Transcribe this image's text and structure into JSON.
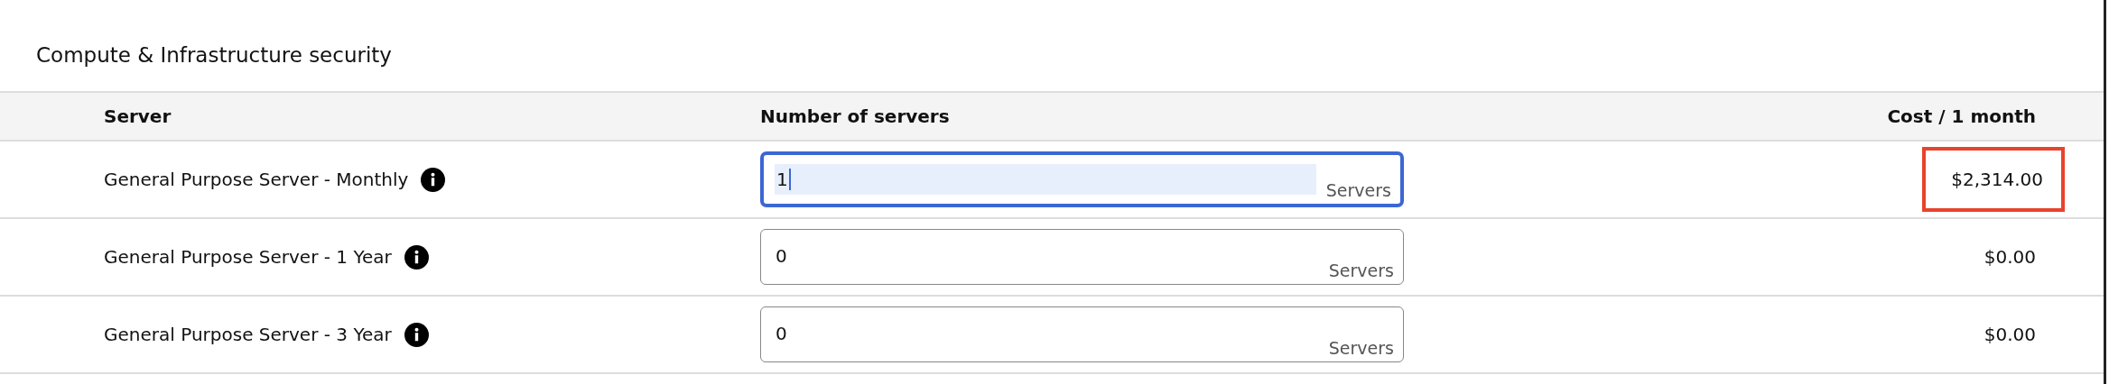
{
  "section": {
    "title": "Compute & Infrastructure security"
  },
  "table": {
    "columns": [
      "Server",
      "Number of servers",
      "Cost / 1 month"
    ],
    "rows": [
      {
        "server": "General Purpose Server - Monthly",
        "quantity": {
          "value": "1",
          "unit": "Servers",
          "focused": true
        },
        "cost": "$2,314.00",
        "highlighted": true
      },
      {
        "server": "General Purpose Server - 1 Year",
        "quantity": {
          "value": "0",
          "unit": "Servers",
          "focused": false
        },
        "cost": "$0.00",
        "highlighted": false
      },
      {
        "server": "General Purpose Server - 3 Year",
        "quantity": {
          "value": "0",
          "unit": "Servers",
          "focused": false
        },
        "cost": "$0.00",
        "highlighted": false
      }
    ]
  }
}
